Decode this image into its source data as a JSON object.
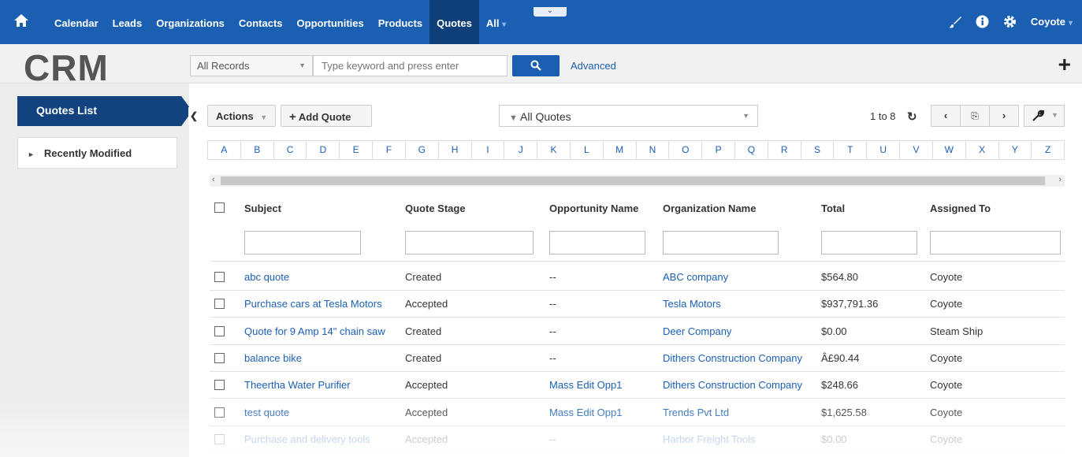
{
  "topbar": {
    "nav": [
      "Calendar",
      "Leads",
      "Organizations",
      "Contacts",
      "Opportunities",
      "Products",
      "Quotes",
      "All"
    ],
    "active": "Quotes",
    "user": "Coyote",
    "colors": {
      "bar": "#1b5fb3",
      "active": "#0e3f78"
    }
  },
  "header": {
    "logo": "CRM",
    "records_select": "All Records",
    "search_placeholder": "Type keyword and press enter",
    "advanced": "Advanced"
  },
  "sidebar": {
    "title": "Quotes List",
    "recent": "Recently Modified"
  },
  "toolbar": {
    "actions": "Actions",
    "add_quote": "Add Quote",
    "filter": "All Quotes",
    "page_info": "1 to 8"
  },
  "alphabet": [
    "A",
    "B",
    "C",
    "D",
    "E",
    "F",
    "G",
    "H",
    "I",
    "J",
    "K",
    "L",
    "M",
    "N",
    "O",
    "P",
    "Q",
    "R",
    "S",
    "T",
    "U",
    "V",
    "W",
    "X",
    "Y",
    "Z"
  ],
  "table": {
    "columns": [
      "Subject",
      "Quote Stage",
      "Opportunity Name",
      "Organization Name",
      "Total",
      "Assigned To"
    ],
    "rows": [
      {
        "subject": "abc quote",
        "stage": "Created",
        "opp": "--",
        "org": "ABC company",
        "total": "$564.80",
        "assigned": "Coyote"
      },
      {
        "subject": "Purchase cars at Tesla Motors",
        "stage": "Accepted",
        "opp": "--",
        "org": "Tesla Motors",
        "total": "$937,791.36",
        "assigned": "Coyote"
      },
      {
        "subject": "Quote for 9 Amp 14\" chain saw",
        "stage": "Created",
        "opp": "--",
        "org": "Deer Company",
        "total": "$0.00",
        "assigned": "Steam Ship"
      },
      {
        "subject": "balance bike",
        "stage": "Created",
        "opp": "--",
        "org": "Dithers Construction Company",
        "total": "Â£90.44",
        "assigned": "Coyote"
      },
      {
        "subject": "Theertha Water Purifier",
        "stage": "Accepted",
        "opp": "Mass Edit Opp1",
        "org": "Dithers Construction Company",
        "total": "$248.66",
        "assigned": "Coyote"
      },
      {
        "subject": "test quote",
        "stage": "Accepted",
        "opp": "Mass Edit Opp1",
        "org": "Trends Pvt Ltd",
        "total": "$1,625.58",
        "assigned": "Coyote"
      },
      {
        "subject": "Purchase and delivery tools",
        "stage": "Accepted",
        "opp": "--",
        "org": "Harbor Freight Tools",
        "total": "$0.00",
        "assigned": "Coyote"
      }
    ]
  }
}
